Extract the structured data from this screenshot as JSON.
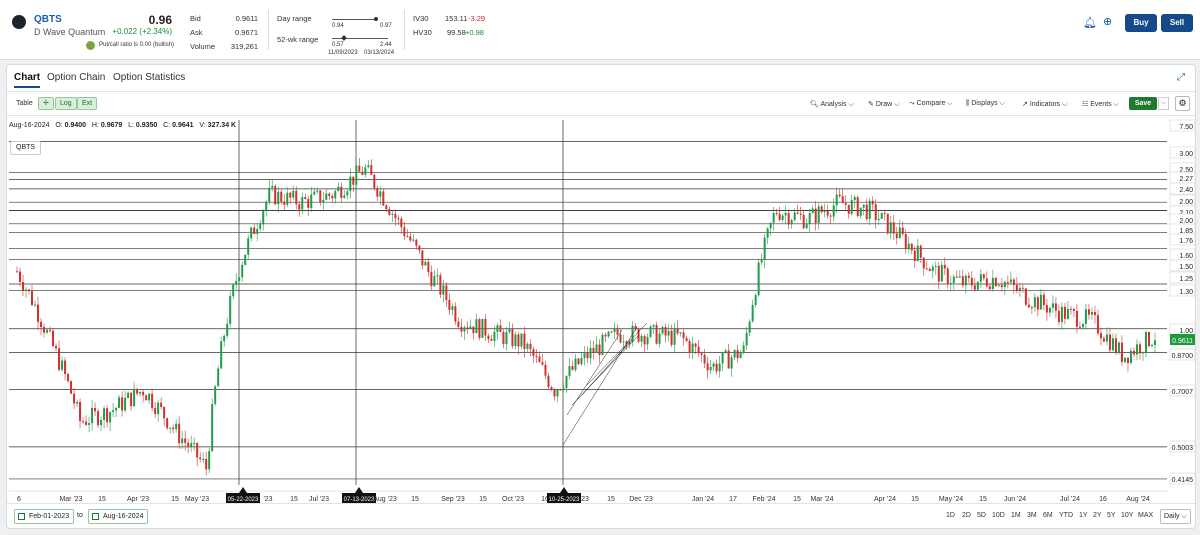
{
  "quote": {
    "symbol": "QBTS",
    "name": "D Wave Quantum",
    "price": "0.96",
    "change": "+0.022 (+2.34%)",
    "put_call": "Put/call ratio is 0.00 (bullish)",
    "bid_label": "Bid",
    "bid": "0.9611",
    "ask_label": "Ask",
    "ask": "0.9671",
    "volume_label": "Volume",
    "volume": "319,261",
    "day_range_label": "Day range",
    "day_low": "0.94",
    "day_high": "0.97",
    "wk52_label": "52-wk range",
    "wk52_low": "0.57",
    "wk52_high": "2.44",
    "wk52_low_date": "11/09/2023",
    "wk52_high_date": "03/13/2024",
    "iv30_label": "IV30",
    "iv30": "153.11",
    "iv30_chg": "-3.29",
    "hv30_label": "HV30",
    "hv30": "99.58",
    "hv30_chg": "+0.98"
  },
  "actions": {
    "buy": "Buy",
    "sell": "Sell"
  },
  "tabs": [
    "Chart",
    "Option Chain",
    "Option Statistics"
  ],
  "toolbar": {
    "table": "Table",
    "log": "Log",
    "ext": "Ext",
    "analysis": "Analysis",
    "draw": "Draw",
    "compare": "Compare",
    "displays": "Displays",
    "indicators": "Indicators",
    "events": "Events",
    "save": "Save"
  },
  "ohlc": {
    "date": "Aug-16-2024",
    "o": "0.9400",
    "h": "0.9679",
    "l": "0.9350",
    "c": "0.9641",
    "v": "327.34 K"
  },
  "chart_tag": "QBTS",
  "colors": {
    "up": "#1f9d48",
    "down": "#d32f2f",
    "accent": "#144a8a"
  },
  "chart_data": {
    "type": "candlestick",
    "symbol": "QBTS",
    "x_tick_labels": [
      "6",
      "Mar '23",
      "15",
      "Apr '23",
      "15",
      "May '23",
      "05-22-2023",
      "'23",
      "15",
      "Jul '23",
      "07-13-2023",
      "Aug '23",
      "15",
      "Sep '23",
      "15",
      "Oct '23",
      "16",
      "10-25-2023",
      "23",
      "15",
      "Dec '23",
      "Jan '24",
      "17",
      "Feb '24",
      "15",
      "Mar '24",
      "Apr '24",
      "15",
      "May '24",
      "15",
      "Jun '24",
      "Jul '24",
      "16",
      "Aug '24"
    ],
    "marker_dates": [
      "05-22-2023",
      "07-13-2023",
      "10-25-2023"
    ],
    "y_labels": [
      "7.50",
      "3.00",
      "2.50",
      "2.27",
      "2.40",
      "2.00",
      "2.10",
      "2.00",
      "1.85",
      "1.76",
      "1.60",
      "1.50",
      "1.25",
      "1.30",
      "1.00",
      "0.9611",
      "0.8700",
      "0.7007",
      "0.5003",
      "0.4145"
    ],
    "horizontal_levels": [
      3.0,
      2.5,
      2.27,
      2.4,
      2.0,
      2.1,
      2.0,
      1.85,
      1.76,
      1.6,
      1.5,
      1.25,
      1.3,
      1.0,
      0.87,
      0.7007,
      0.5003,
      0.4145
    ],
    "last_price": 0.9611,
    "series": [
      {
        "x": [
          "Feb-23",
          "Mar-23",
          "Mar-23b",
          "Apr-23",
          "Apr-23b",
          "May-23",
          "May-23b",
          "Jun-23",
          "Jun-23b",
          "Jul-23",
          "Jul-23b",
          "Aug-23",
          "Aug-23b",
          "Sep-23",
          "Sep-23b",
          "Oct-23",
          "Oct-23b",
          "Nov-23",
          "Nov-23b",
          "Dec-23",
          "Dec-23b",
          "Jan-24",
          "Jan-24b",
          "Feb-24",
          "Feb-24b",
          "Mar-24",
          "Mar-24b",
          "Apr-24",
          "Apr-24b",
          "May-24",
          "May-24b",
          "Jun-24",
          "Jun-24b",
          "Jul-24",
          "Jul-24b",
          "Aug-24",
          "Aug-24b"
        ],
        "close": [
          1.4,
          0.95,
          0.58,
          0.62,
          0.7,
          0.55,
          0.44,
          1.4,
          2.2,
          2.1,
          2.2,
          2.55,
          1.9,
          1.4,
          1.05,
          0.98,
          0.92,
          0.7,
          0.85,
          0.97,
          0.97,
          0.95,
          0.8,
          0.88,
          2.0,
          1.9,
          2.1,
          2.0,
          1.7,
          1.4,
          1.3,
          1.35,
          1.2,
          1.1,
          1.05,
          0.85,
          0.96
        ]
      }
    ],
    "grid": false,
    "legend": "none"
  },
  "range": {
    "from": "Feb-01-2023",
    "to_label": "to",
    "to": "Aug-16-2024"
  },
  "timeframes": [
    "1D",
    "2D",
    "5D",
    "10D",
    "1M",
    "3M",
    "6M",
    "YTD",
    "1Y",
    "2Y",
    "5Y",
    "10Y",
    "MAX"
  ],
  "interval": "Daily"
}
